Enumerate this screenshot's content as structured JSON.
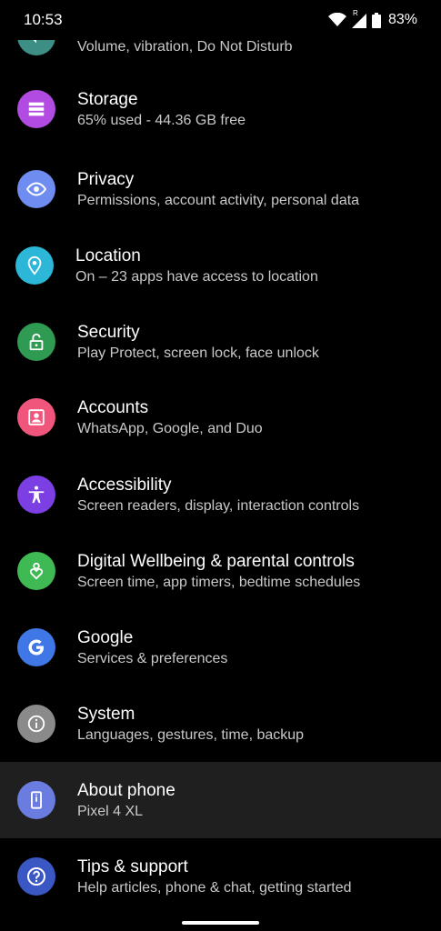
{
  "status": {
    "time": "10:53",
    "roaming_badge": "R",
    "battery": "83%"
  },
  "colors": {
    "sound": "#3d8f85",
    "storage": "#b14be2",
    "privacy": "#6f8cf0",
    "location": "#2cb6d8",
    "security": "#2f9a52",
    "accounts": "#f0567b",
    "accessibility": "#7b3fe3",
    "wellbeing": "#3fb954",
    "google": "#3f77e6",
    "system": "#8a8a8a",
    "about": "#6a7cdf",
    "tips": "#3a57c4"
  },
  "settings": {
    "sound": {
      "subtitle": "Volume, vibration, Do Not Disturb",
      "icon": "volume-icon"
    },
    "storage": {
      "title": "Storage",
      "subtitle": "65% used - 44.36 GB free",
      "icon": "storage-icon"
    },
    "privacy": {
      "title": "Privacy",
      "subtitle": "Permissions, account activity, personal data",
      "icon": "eye-icon"
    },
    "location": {
      "title": "Location",
      "subtitle": "On – 23 apps have access to location",
      "icon": "location-pin-icon"
    },
    "security": {
      "title": "Security",
      "subtitle": "Play Protect, screen lock, face unlock",
      "icon": "lock-icon"
    },
    "accounts": {
      "title": "Accounts",
      "subtitle": "WhatsApp, Google, and Duo",
      "icon": "account-box-icon"
    },
    "accessibility": {
      "title": "Accessibility",
      "subtitle": "Screen readers, display, interaction controls",
      "icon": "accessibility-icon"
    },
    "wellbeing": {
      "title": "Digital Wellbeing & parental controls",
      "subtitle": "Screen time, app timers, bedtime schedules",
      "icon": "wellbeing-icon"
    },
    "google": {
      "title": "Google",
      "subtitle": "Services & preferences",
      "icon": "google-icon"
    },
    "system": {
      "title": "System",
      "subtitle": "Languages, gestures, time, backup",
      "icon": "info-icon"
    },
    "about": {
      "title": "About phone",
      "subtitle": "Pixel 4 XL",
      "icon": "phone-icon"
    },
    "tips": {
      "title": "Tips & support",
      "subtitle": "Help articles, phone & chat, getting started",
      "icon": "help-icon"
    }
  }
}
